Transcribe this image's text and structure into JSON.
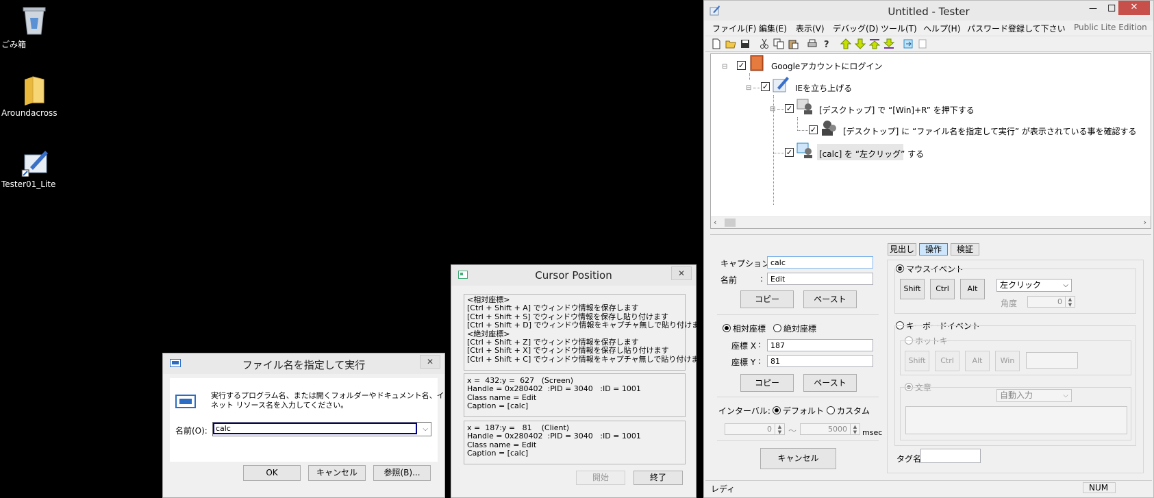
{
  "desktop": {
    "icons": [
      {
        "label": "ごみ箱",
        "icon": "recycle-bin-icon"
      },
      {
        "label": "Aroundacross",
        "icon": "folder-icon"
      },
      {
        "label": "Tester01_Lite",
        "icon": "tester-shortcut-icon"
      }
    ]
  },
  "run_dialog": {
    "title": "ファイル名を指定して実行",
    "description_line1": "実行するプログラム名、または開くフォルダーやドキュメント名、インター",
    "description_line2": "ネット リソース名を入力してください。",
    "name_label": "名前(O):",
    "name_value": "calc",
    "ok": "OK",
    "cancel": "キャンセル",
    "browse": "参照(B)..."
  },
  "cursor_window": {
    "title": "Cursor Position",
    "help_text": "<相対座標>\n[Ctrl + Shift + A] でウィンドウ情報を保存します\n[Ctrl + Shift + S] でウィンドウ情報を保存し貼り付けます\n[Ctrl + Shift + D] でウィンドウ情報をキャプチャ無しで貼り付けます\n<絶対座標>\n[Ctrl + Shift + Z] でウィンドウ情報を保存します\n[Ctrl + Shift + X] でウィンドウ情報を保存し貼り付けます\n[Ctrl + Shift + C] でウィンドウ情報をキャプチャ無しで貼り付けます",
    "screen_info": "x =  432:y =  627   (Screen)\nHandle = 0x280402  :PID = 3040   :ID = 1001\nClass name = Edit\nCaption = [calc]",
    "client_info": "x =  187:y =   81    (Client)\nHandle = 0x280402  :PID = 3040   :ID = 1001\nClass name = Edit\nCaption = [calc]",
    "start": "開始",
    "end": "終了"
  },
  "tester": {
    "title": "Untitled - Tester",
    "menu": [
      "ファイル(F)",
      "編集(E)",
      "表示(V)",
      "デバッグ(D)",
      "ツール(T)",
      "ヘルプ(H)",
      "パスワード登録して下さい"
    ],
    "edition": "Public Lite Edition",
    "tree": [
      {
        "label": "Googleアカウントにログイン"
      },
      {
        "label": "IEを立ち上げる"
      },
      {
        "label": "[デスクトップ] で “[Win]+R” を押下する"
      },
      {
        "label": "[デスクトップ] に “ファイル名を指定して実行” が表示されている事を確認する"
      },
      {
        "label": "[calc] を “左クリッグ” する"
      }
    ],
    "tabs": [
      "見出し",
      "操作",
      "検証"
    ],
    "caption_label": "キャプション:",
    "caption_value": "calc",
    "name_label": "名前",
    "name_colon": ":",
    "name_value": "Edit",
    "copy": "コピー",
    "paste": "ペースト",
    "relative": "相対座標",
    "absolute": "絶対座標",
    "coord_x_label": "座標 X",
    "coord_y_label": "座標 Y",
    "colon": ":",
    "coord_x": "187",
    "coord_y": "81",
    "interval_label": "インターバル:",
    "default": "デフォルト",
    "custom": "カスタム",
    "interval_min": "0",
    "interval_max": "5000",
    "tilde": "～",
    "msec": "msec",
    "cancel": "キャンセル",
    "mouse_event": "マウスイベント",
    "shift": "Shift",
    "ctrl": "Ctrl",
    "alt": "Alt",
    "win": "Win",
    "click_type": "左クリック",
    "angle_label": "角度",
    "angle_value": "0",
    "keyboard_event": "キーボードイベント",
    "hotkey": "ホットキー",
    "sentence": "文章",
    "auto_input": "自動入力",
    "tag_label": "タグ名",
    "status": "レディ",
    "num": "NUM"
  }
}
